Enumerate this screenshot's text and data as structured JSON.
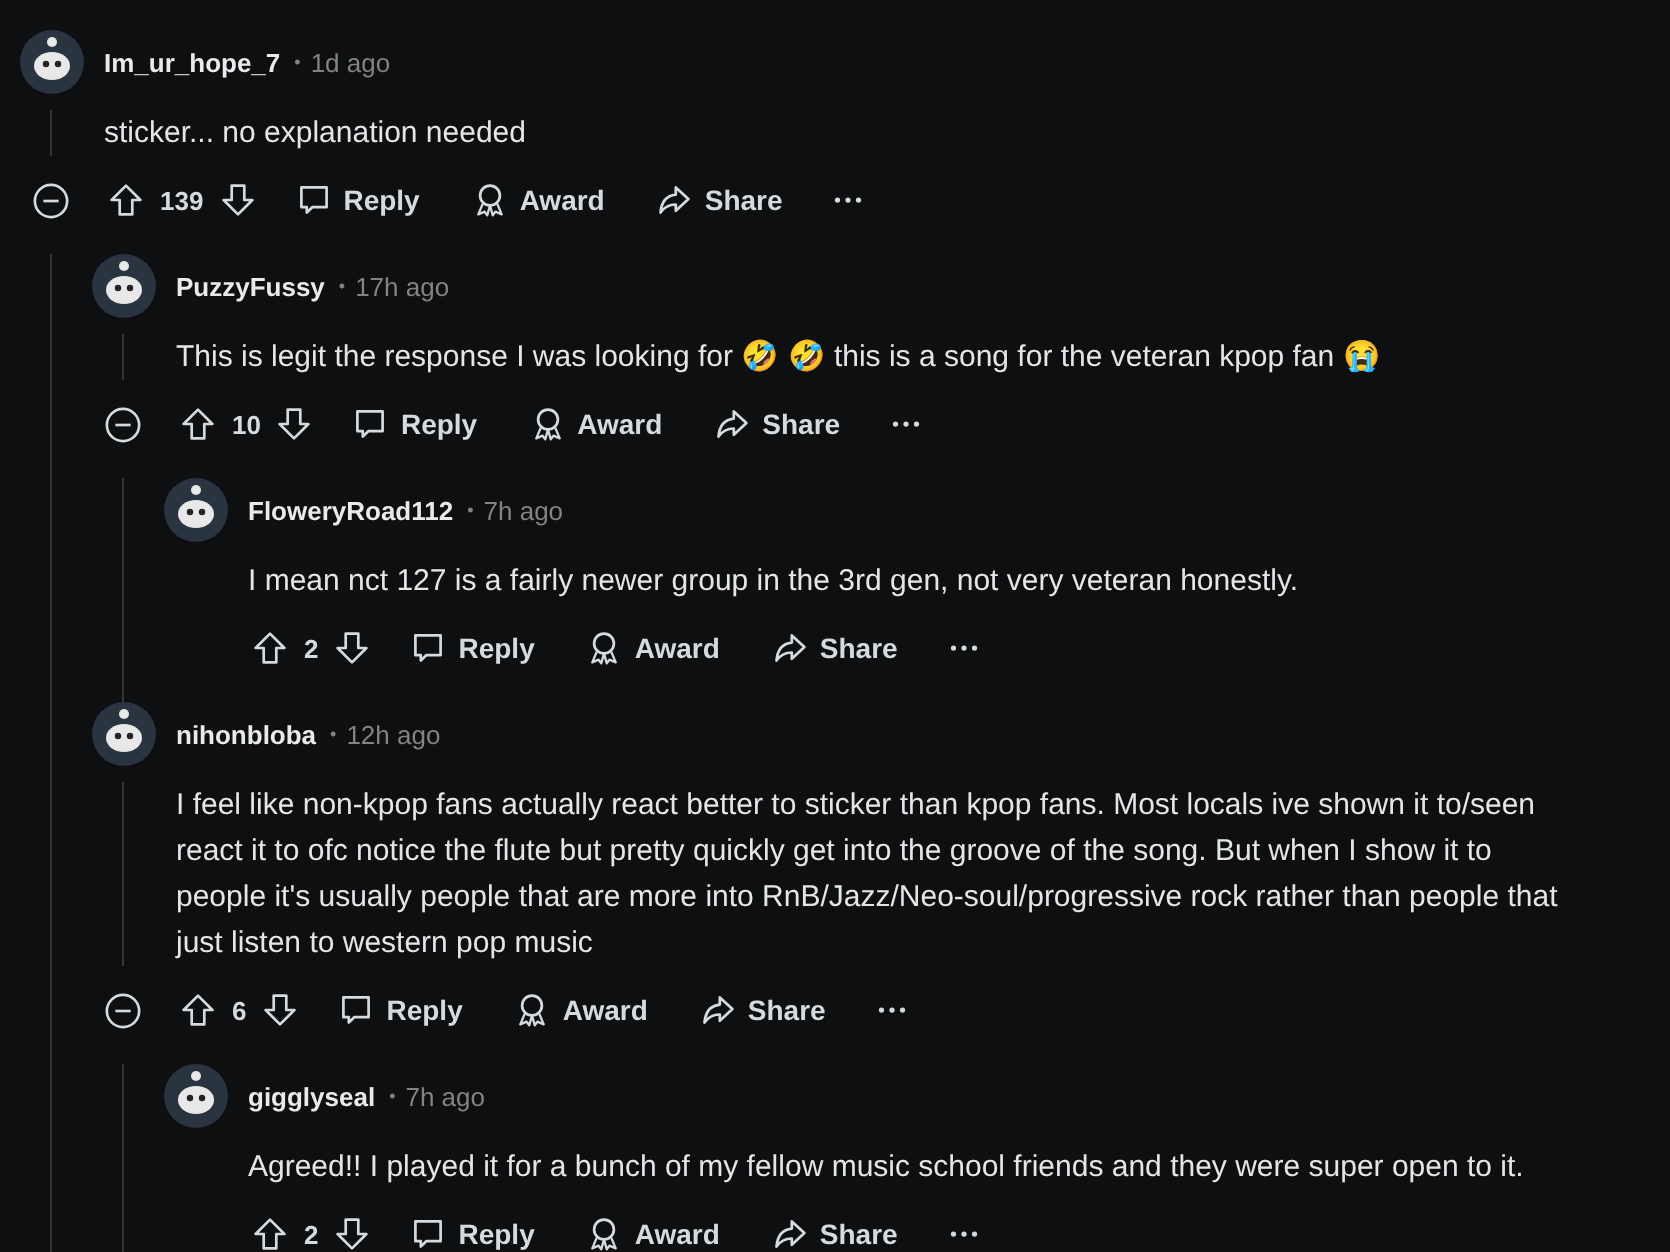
{
  "comments": [
    {
      "author": "Im_ur_hope_7",
      "separator": "•",
      "time": "1d ago",
      "body": "sticker... no explanation needed",
      "score": "139",
      "actions": [
        "Reply",
        "Award",
        "Share"
      ],
      "children": [
        {
          "author": "PuzzyFussy",
          "separator": "•",
          "time": "17h ago",
          "body": "This is legit the response I was looking for 🤣 🤣 this is a song for the veteran kpop fan 😭",
          "score": "10",
          "actions": [
            "Reply",
            "Award",
            "Share"
          ],
          "children": [
            {
              "author": "FloweryRoad112",
              "separator": "•",
              "time": "7h ago",
              "body": "I mean nct 127 is a fairly newer group in the 3rd gen, not very veteran honestly.",
              "score": "2",
              "actions": [
                "Reply",
                "Award",
                "Share"
              ]
            }
          ]
        },
        {
          "author": "nihonbloba",
          "separator": "•",
          "time": "12h ago",
          "body": "I feel like non-kpop fans actually react better to sticker than kpop fans. Most locals ive shown it to/seen react it to ofc notice the flute but pretty quickly get into the groove of the song. But when I show it to people it's usually people that are more into RnB/Jazz/Neo-soul/progressive rock rather than people that just listen to western pop music",
          "score": "6",
          "actions": [
            "Reply",
            "Award",
            "Share"
          ],
          "children": [
            {
              "author": "gigglyseal",
              "separator": "•",
              "time": "7h ago",
              "body": "Agreed!! I played it for a bunch of my fellow music school friends and they were super open to it.",
              "score": "2",
              "actions": [
                "Reply",
                "Award",
                "Share"
              ]
            }
          ]
        }
      ]
    }
  ]
}
